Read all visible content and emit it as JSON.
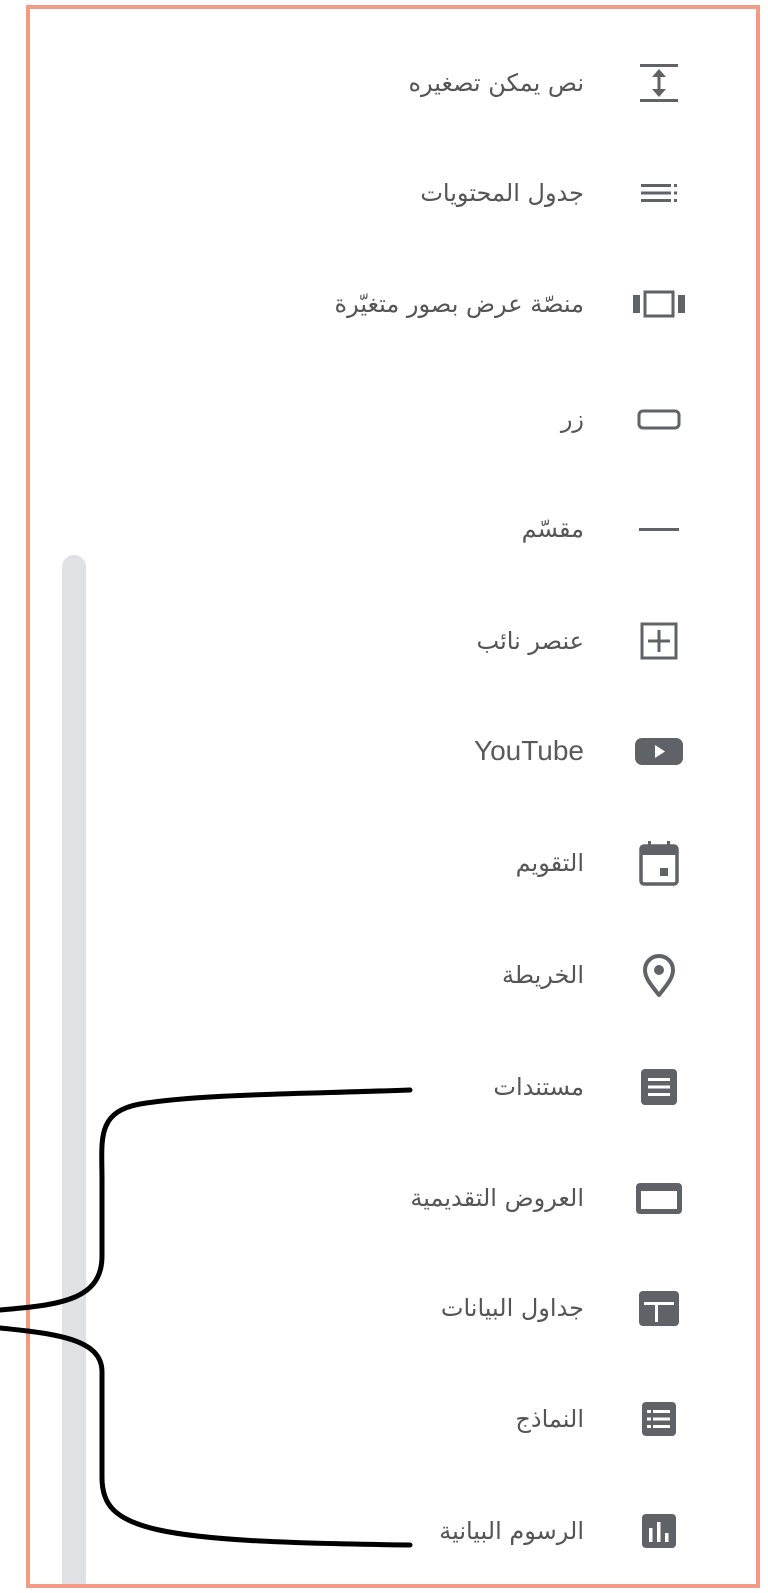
{
  "menu": {
    "items": [
      {
        "label": "نص يمكن تصغيره",
        "icon": "collapsible-text-icon"
      },
      {
        "label": "جدول المحتويات",
        "icon": "table-of-contents-icon"
      },
      {
        "label": "منصّة عرض بصور متغيّرة",
        "icon": "carousel-icon"
      },
      {
        "label": "زر",
        "icon": "button-icon"
      },
      {
        "label": "مقسّم",
        "icon": "divider-icon"
      },
      {
        "label": "عنصر نائب",
        "icon": "placeholder-icon"
      },
      {
        "label": "YouTube",
        "icon": "youtube-icon"
      },
      {
        "label": "التقويم",
        "icon": "calendar-icon"
      },
      {
        "label": "الخريطة",
        "icon": "map-pin-icon"
      },
      {
        "label": "مستندات",
        "icon": "docs-icon"
      },
      {
        "label": "العروض التقديمية",
        "icon": "slides-icon"
      },
      {
        "label": "جداول البيانات",
        "icon": "sheets-icon"
      },
      {
        "label": "النماذج",
        "icon": "forms-icon"
      },
      {
        "label": "الرسوم البيانية",
        "icon": "charts-icon"
      }
    ]
  },
  "colors": {
    "frame_border": "#f29a83",
    "icon": "#5f6368",
    "text": "#555555",
    "scroll_track": "#dfe1e5",
    "annotation_stroke": "#000000"
  }
}
